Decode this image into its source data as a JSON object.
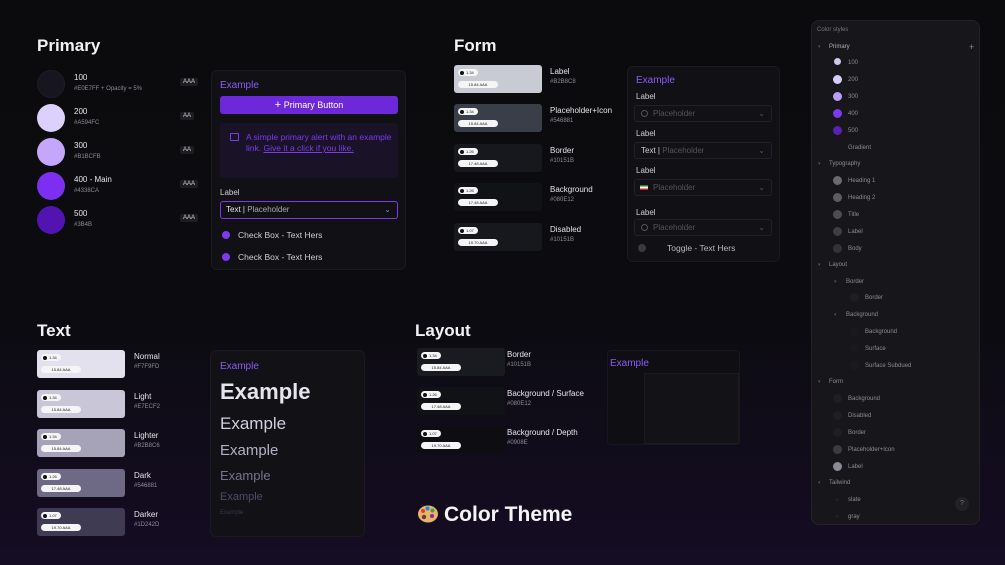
{
  "primary": {
    "title": "Primary",
    "swatches": [
      {
        "name": "100",
        "hex": "#E0E7FF + Opacity = 5%",
        "badge": "AAA",
        "color": "#17151f"
      },
      {
        "name": "200",
        "hex": "#A594FC",
        "badge": "AA",
        "color": "#dcd0fd"
      },
      {
        "name": "300",
        "hex": "#B1BCFB",
        "badge": "AA",
        "color": "#c4a6fb"
      },
      {
        "name": "400 - Main",
        "hex": "#4338CA",
        "badge": "AAA",
        "color": "#7c2ff0"
      },
      {
        "name": "500",
        "hex": "#3B4B",
        "badge": "AAA",
        "color": "#5114b0"
      }
    ],
    "example": {
      "label": "Example",
      "button": "Primary Button",
      "alert_text": "A simple primary alert with an example link.",
      "alert_link": "Give it a click if you like.",
      "field_label": "Label",
      "field_value": "Text |",
      "field_placeholder": "Placeholder",
      "checkbox1": "Check Box  - Text Hers",
      "checkbox2": "Check Box - Text Hers"
    }
  },
  "form": {
    "title": "Form",
    "tokens": [
      {
        "name": "Label",
        "hex": "#B2B8C8",
        "pill": "15.84 AAA",
        "badge": "1.34"
      },
      {
        "name": "Placeholder+Icon",
        "hex": "#546881",
        "pill": "15.84 AAA",
        "badge": "1.34"
      },
      {
        "name": "Border",
        "hex": "#10151B",
        "pill": "17.48 AAA",
        "badge": "1.26"
      },
      {
        "name": "Background",
        "hex": "#080E12",
        "pill": "17.48 AAA",
        "badge": "1.26"
      },
      {
        "name": "Disabled",
        "hex": "#10151B",
        "pill": "19.70 AAA",
        "badge": "1.07"
      }
    ],
    "example": {
      "label": "Example",
      "labels": [
        "Label",
        "Label",
        "Label",
        "Label"
      ],
      "placeholder": "Placeholder",
      "text_prefix": "Text |",
      "toggle": "Toggle - Text Hers"
    }
  },
  "text": {
    "title": "Text",
    "tokens": [
      {
        "name": "Normal",
        "hex": "#F7F9FD",
        "pill": "15.84 AAA",
        "badge": "1.34",
        "color": "#e3e1ee"
      },
      {
        "name": "Light",
        "hex": "#E7ECF2",
        "pill": "15.84 AAA",
        "badge": "1.34",
        "color": "#c9c6d8"
      },
      {
        "name": "Lighter",
        "hex": "#B2B8C6",
        "pill": "15.84 AAA",
        "badge": "1.34",
        "color": "#a6a3b8"
      },
      {
        "name": "Dark",
        "hex": "#546881",
        "pill": "17.48 AAA",
        "badge": "1.26",
        "color": "#6e6a85"
      },
      {
        "name": "Darker",
        "hex": "#1D242D",
        "pill": "19.70 AAA",
        "badge": "1.07",
        "color": "#3f3b52"
      }
    ],
    "example": {
      "label": "Example",
      "samples": [
        "Example",
        "Example",
        "Example",
        "Example",
        "Example",
        "Example"
      ]
    }
  },
  "layout": {
    "title": "Layout",
    "tokens": [
      {
        "name": "Border",
        "hex": "#10151B",
        "pill": "15.84 AAA",
        "badge": "1.34"
      },
      {
        "name": "Background / Surface",
        "hex": "#080E12",
        "pill": "17.48 AAA",
        "badge": "1.26"
      },
      {
        "name": "Background / Depth",
        "hex": "#0908E",
        "pill": "19.70 AAA",
        "badge": "1.07"
      }
    ],
    "example": {
      "label": "Example"
    }
  },
  "brand": {
    "title": "Color Theme",
    "icon": "palette-icon"
  },
  "panel": {
    "header": "Color styles",
    "primary_group": "Primary",
    "primary_items": [
      "100",
      "200",
      "300",
      "400",
      "500",
      "Gradient"
    ],
    "typography_group": "Typography",
    "typography_items": [
      "Heading 1",
      "Heading 2",
      "Title",
      "Label",
      "Body"
    ],
    "layout_group": "Layout",
    "border_group": "Border",
    "border_items": [
      "Border"
    ],
    "background_group": "Background",
    "background_items": [
      "Background",
      "Surface",
      "Surface Subdued"
    ],
    "form_group": "Form",
    "form_items": [
      "Background",
      "Disabled",
      "Border",
      "Placeholder+Icon",
      "Label"
    ],
    "tailwind_group": "Tailwind",
    "tailwind_items": [
      "slate",
      "gray"
    ],
    "add": "+",
    "help": "?"
  }
}
